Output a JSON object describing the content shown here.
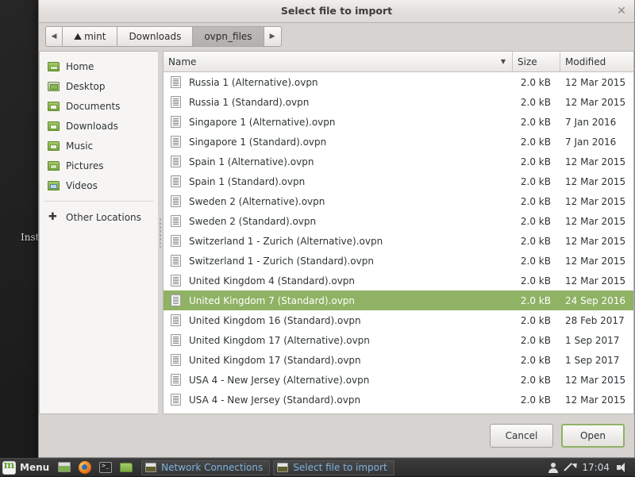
{
  "desktop": {
    "visible_icon_label": "Inst"
  },
  "dialog": {
    "title": "Select file to import",
    "close_icon": "close-icon",
    "pathbar": {
      "back_icon": "◀",
      "forward_icon": "▶",
      "crumbs": [
        {
          "label": "mint",
          "icon": "home-icon",
          "active": false
        },
        {
          "label": "Downloads",
          "icon": "",
          "active": false
        },
        {
          "label": "ovpn_files",
          "icon": "",
          "active": true
        }
      ]
    },
    "sidebar": {
      "places": [
        {
          "label": "Home",
          "icon": "home-folder-icon"
        },
        {
          "label": "Desktop",
          "icon": "desktop-folder-icon"
        },
        {
          "label": "Documents",
          "icon": "documents-folder-icon"
        },
        {
          "label": "Downloads",
          "icon": "downloads-folder-icon"
        },
        {
          "label": "Music",
          "icon": "music-folder-icon"
        },
        {
          "label": "Pictures",
          "icon": "pictures-folder-icon"
        },
        {
          "label": "Videos",
          "icon": "videos-folder-icon"
        }
      ],
      "other_locations": {
        "label": "Other Locations",
        "icon": "plus-icon"
      }
    },
    "file_list": {
      "columns": {
        "name": "Name",
        "size": "Size",
        "modified": "Modified"
      },
      "sort_indicator": "▼",
      "rows": [
        {
          "name": "Russia 1 (Alternative).ovpn",
          "size": "2.0 kB",
          "modified": "12 Mar 2015",
          "selected": false
        },
        {
          "name": "Russia 1 (Standard).ovpn",
          "size": "2.0 kB",
          "modified": "12 Mar 2015",
          "selected": false
        },
        {
          "name": "Singapore 1 (Alternative).ovpn",
          "size": "2.0 kB",
          "modified": "7 Jan 2016",
          "selected": false
        },
        {
          "name": "Singapore 1 (Standard).ovpn",
          "size": "2.0 kB",
          "modified": "7 Jan 2016",
          "selected": false
        },
        {
          "name": "Spain 1 (Alternative).ovpn",
          "size": "2.0 kB",
          "modified": "12 Mar 2015",
          "selected": false
        },
        {
          "name": "Spain 1 (Standard).ovpn",
          "size": "2.0 kB",
          "modified": "12 Mar 2015",
          "selected": false
        },
        {
          "name": "Sweden 2 (Alternative).ovpn",
          "size": "2.0 kB",
          "modified": "12 Mar 2015",
          "selected": false
        },
        {
          "name": "Sweden 2 (Standard).ovpn",
          "size": "2.0 kB",
          "modified": "12 Mar 2015",
          "selected": false
        },
        {
          "name": "Switzerland 1 - Zurich (Alternative).ovpn",
          "size": "2.0 kB",
          "modified": "12 Mar 2015",
          "selected": false
        },
        {
          "name": "Switzerland 1 - Zurich (Standard).ovpn",
          "size": "2.0 kB",
          "modified": "12 Mar 2015",
          "selected": false
        },
        {
          "name": "United Kingdom 4 (Standard).ovpn",
          "size": "2.0 kB",
          "modified": "12 Mar 2015",
          "selected": false
        },
        {
          "name": "United Kingdom 7 (Standard).ovpn",
          "size": "2.0 kB",
          "modified": "24 Sep 2016",
          "selected": true
        },
        {
          "name": "United Kingdom 16 (Standard).ovpn",
          "size": "2.0 kB",
          "modified": "28 Feb 2017",
          "selected": false
        },
        {
          "name": "United Kingdom 17 (Alternative).ovpn",
          "size": "2.0 kB",
          "modified": "1 Sep 2017",
          "selected": false
        },
        {
          "name": "United Kingdom 17 (Standard).ovpn",
          "size": "2.0 kB",
          "modified": "1 Sep 2017",
          "selected": false
        },
        {
          "name": "USA 4 - New Jersey (Alternative).ovpn",
          "size": "2.0 kB",
          "modified": "12 Mar 2015",
          "selected": false
        },
        {
          "name": "USA 4 - New Jersey (Standard).ovpn",
          "size": "2.0 kB",
          "modified": "12 Mar 2015",
          "selected": false
        }
      ]
    },
    "actions": {
      "cancel": "Cancel",
      "open": "Open"
    }
  },
  "taskbar": {
    "menu_label": "Menu",
    "launchers": [
      {
        "name": "show-desktop-icon"
      },
      {
        "name": "firefox-icon"
      },
      {
        "name": "terminal-icon"
      },
      {
        "name": "file-manager-icon"
      }
    ],
    "tasks": [
      {
        "label": "Network Connections"
      },
      {
        "label": "Select file to import"
      }
    ],
    "tray": {
      "user_icon": "user-icon",
      "update_icon": "update-manager-icon",
      "clock": "17:04",
      "volume_icon": "volume-icon"
    }
  },
  "colors": {
    "selection_green": "#8fb264",
    "dialog_bg": "#d6d3d0",
    "taskbar_bg": "#2c2c2c",
    "task_label_blue": "#7fb3e0"
  }
}
